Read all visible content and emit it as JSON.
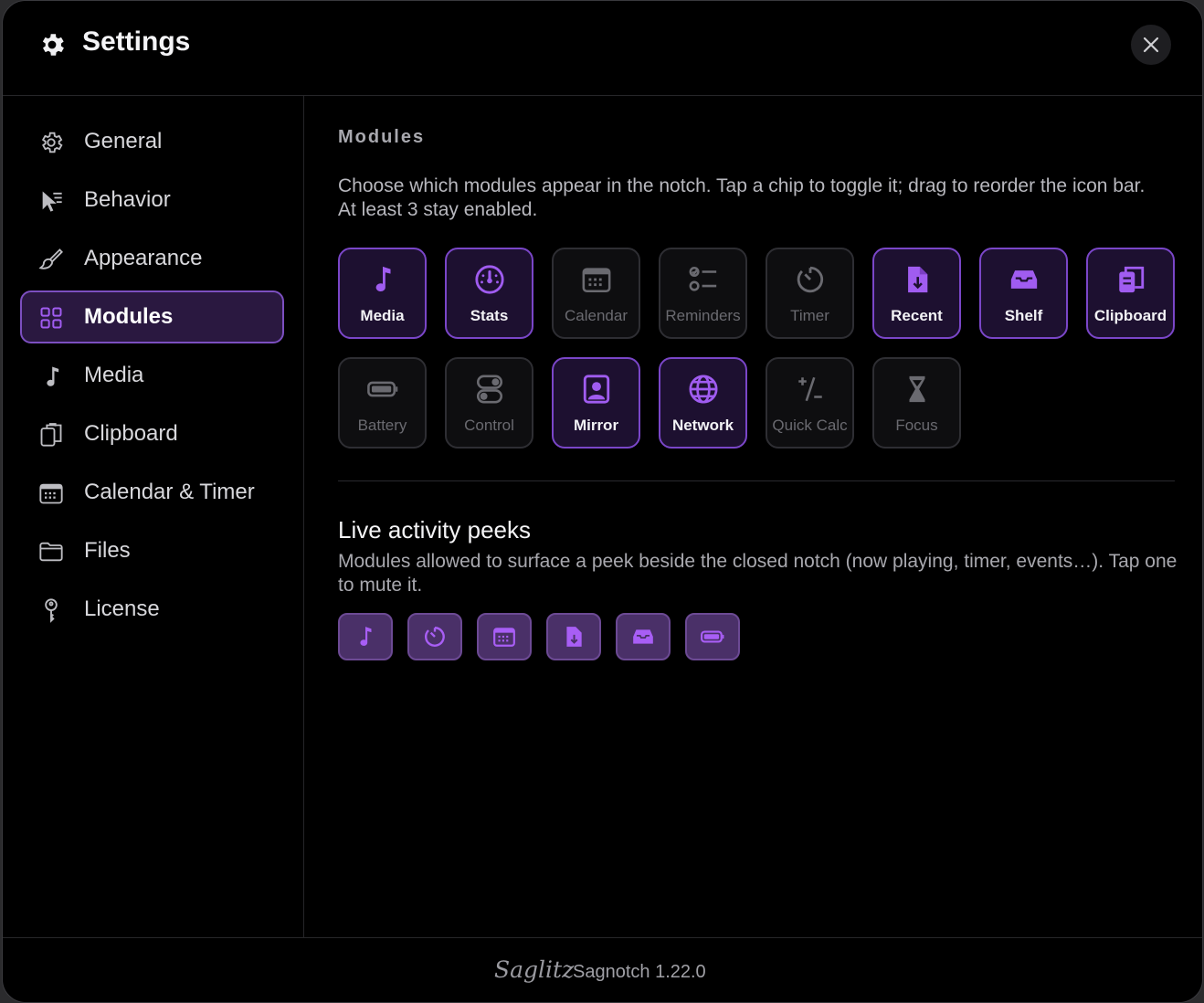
{
  "window": {
    "title": "Settings",
    "title_icon": "gear-icon",
    "close_icon": "close-icon"
  },
  "sidebar": {
    "items": [
      {
        "label": "General",
        "icon": "gear-outline-icon",
        "active": false
      },
      {
        "label": "Behavior",
        "icon": "cursor-icon",
        "active": false
      },
      {
        "label": "Appearance",
        "icon": "brush-icon",
        "active": false
      },
      {
        "label": "Modules",
        "icon": "grid-icon",
        "active": true
      },
      {
        "label": "Media",
        "icon": "music-note-icon",
        "active": false
      },
      {
        "label": "Clipboard",
        "icon": "clipboard-icon",
        "active": false
      },
      {
        "label": "Calendar & Timer",
        "icon": "calendar-icon",
        "active": false
      },
      {
        "label": "Files",
        "icon": "folder-icon",
        "active": false
      },
      {
        "label": "License",
        "icon": "key-icon",
        "active": false
      }
    ]
  },
  "modules": {
    "heading": "Modules",
    "description": "Choose which modules appear in the notch. Tap a chip to toggle it; drag to reorder the icon bar. At least 3 stay enabled.",
    "chips": [
      {
        "label": "Media",
        "icon": "music-note-icon",
        "enabled": true
      },
      {
        "label": "Stats",
        "icon": "gauge-icon",
        "enabled": true
      },
      {
        "label": "Calendar",
        "icon": "calendar-icon",
        "enabled": false
      },
      {
        "label": "Reminders",
        "icon": "checklist-icon",
        "enabled": false
      },
      {
        "label": "Timer",
        "icon": "timer-icon",
        "enabled": false
      },
      {
        "label": "Recent",
        "icon": "doc-download-icon",
        "enabled": true
      },
      {
        "label": "Shelf",
        "icon": "tray-icon",
        "enabled": true
      },
      {
        "label": "Clipboard",
        "icon": "clipboard-icon",
        "enabled": true
      },
      {
        "label": "Battery",
        "icon": "battery-icon",
        "enabled": false
      },
      {
        "label": "Control",
        "icon": "toggles-icon",
        "enabled": false
      },
      {
        "label": "Mirror",
        "icon": "person-square-icon",
        "enabled": true
      },
      {
        "label": "Network",
        "icon": "globe-icon",
        "enabled": true
      },
      {
        "label": "Quick Calc",
        "icon": "plus-minus-icon",
        "enabled": false
      },
      {
        "label": "Focus",
        "icon": "hourglass-icon",
        "enabled": false
      }
    ]
  },
  "peeks": {
    "title": "Live activity peeks",
    "description": "Modules allowed to surface a peek beside the closed notch (now playing, timer, events…). Tap one to mute it.",
    "items": [
      {
        "icon": "music-note-icon"
      },
      {
        "icon": "timer-icon"
      },
      {
        "icon": "calendar-icon"
      },
      {
        "icon": "doc-download-icon"
      },
      {
        "icon": "tray-icon"
      },
      {
        "icon": "battery-icon"
      }
    ]
  },
  "footer": {
    "brand": "Saglitz",
    "version": "Sagnotch 1.22.0"
  },
  "colors": {
    "accent": "#a05cf0",
    "accent_border": "#7a46c8",
    "background": "#000000"
  }
}
